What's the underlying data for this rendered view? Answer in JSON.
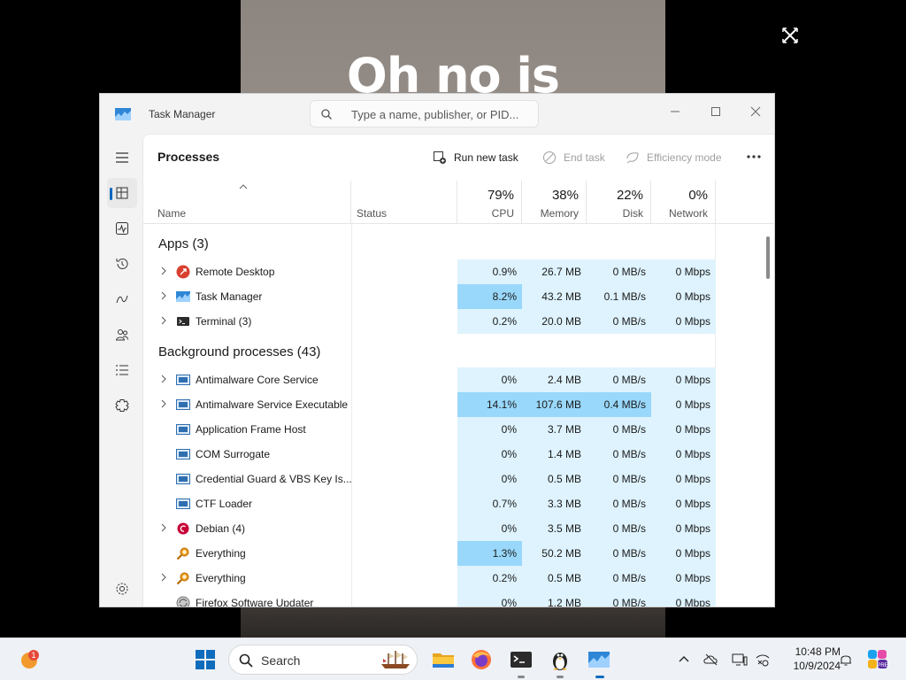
{
  "video": {
    "caption": "Oh no is"
  },
  "window": {
    "title": "Task Manager",
    "search_placeholder": "Type a name, publisher, or PID...",
    "controls": [
      "minimize-icon",
      "maximize-icon",
      "close-icon"
    ]
  },
  "nav": {
    "items": [
      "hamburger-menu-icon",
      "processes-icon",
      "performance-icon",
      "app-history-icon",
      "startup-apps-icon",
      "users-icon",
      "details-icon",
      "services-icon",
      "settings-icon"
    ],
    "selected": "processes"
  },
  "page": {
    "title": "Processes",
    "commands": {
      "run_new_task": "Run new task",
      "end_task": "End task",
      "efficiency_mode": "Efficiency mode"
    }
  },
  "columns": {
    "name": "Name",
    "status": "Status",
    "cpu": {
      "pct": "79%",
      "label": "CPU"
    },
    "memory": {
      "pct": "38%",
      "label": "Memory"
    },
    "disk": {
      "pct": "22%",
      "label": "Disk"
    },
    "network": {
      "pct": "0%",
      "label": "Network"
    }
  },
  "groups": {
    "apps": "Apps (3)",
    "background": "Background processes (43)"
  },
  "apps": [
    {
      "name": "Remote Desktop",
      "icon": "remote-desktop-icon",
      "expandable": true,
      "cpu": "0.9%",
      "memory": "26.7 MB",
      "disk": "0 MB/s",
      "network": "0 Mbps"
    },
    {
      "name": "Task Manager",
      "icon": "task-manager-icon",
      "expandable": true,
      "cpu": "8.2%",
      "memory": "43.2 MB",
      "disk": "0.1 MB/s",
      "network": "0 Mbps"
    },
    {
      "name": "Terminal (3)",
      "icon": "terminal-icon",
      "expandable": true,
      "cpu": "0.2%",
      "memory": "20.0 MB",
      "disk": "0 MB/s",
      "network": "0 Mbps"
    }
  ],
  "background": [
    {
      "name": "Antimalware Core Service",
      "icon": "service-window-icon",
      "expandable": true,
      "cpu": "0%",
      "memory": "2.4 MB",
      "disk": "0 MB/s",
      "network": "0 Mbps"
    },
    {
      "name": "Antimalware Service Executable",
      "icon": "service-window-icon",
      "expandable": true,
      "cpu": "14.1%",
      "memory": "107.6 MB",
      "disk": "0.4 MB/s",
      "network": "0 Mbps"
    },
    {
      "name": "Application Frame Host",
      "icon": "service-window-icon",
      "expandable": false,
      "cpu": "0%",
      "memory": "3.7 MB",
      "disk": "0 MB/s",
      "network": "0 Mbps"
    },
    {
      "name": "COM Surrogate",
      "icon": "service-window-icon",
      "expandable": false,
      "cpu": "0%",
      "memory": "1.4 MB",
      "disk": "0 MB/s",
      "network": "0 Mbps"
    },
    {
      "name": "Credential Guard & VBS Key Is...",
      "icon": "service-window-icon",
      "expandable": false,
      "cpu": "0%",
      "memory": "0.5 MB",
      "disk": "0 MB/s",
      "network": "0 Mbps"
    },
    {
      "name": "CTF Loader",
      "icon": "service-window-icon",
      "expandable": false,
      "cpu": "0.7%",
      "memory": "3.3 MB",
      "disk": "0 MB/s",
      "network": "0 Mbps"
    },
    {
      "name": "Debian (4)",
      "icon": "debian-icon",
      "expandable": true,
      "cpu": "0%",
      "memory": "3.5 MB",
      "disk": "0 MB/s",
      "network": "0 Mbps"
    },
    {
      "name": "Everything",
      "icon": "everything-search-icon",
      "expandable": false,
      "cpu": "1.3%",
      "memory": "50.2 MB",
      "disk": "0 MB/s",
      "network": "0 Mbps"
    },
    {
      "name": "Everything",
      "icon": "everything-search-icon",
      "expandable": true,
      "cpu": "0.2%",
      "memory": "0.5 MB",
      "disk": "0 MB/s",
      "network": "0 Mbps"
    },
    {
      "name": "Firefox Software Updater",
      "icon": "firefox-updater-icon",
      "expandable": false,
      "cpu": "0%",
      "memory": "1.2 MB",
      "disk": "0 MB/s",
      "network": "0 Mbps"
    }
  ],
  "taskbar": {
    "search_label": "Search",
    "time": "10:48 PM",
    "date": "10/9/2024",
    "weather_badge": "1",
    "copilot_badge": "PRE",
    "apps": [
      "start-icon",
      "file-explorer-icon",
      "firefox-icon",
      "terminal-icon",
      "linux-tux-icon",
      "task-manager-icon"
    ]
  }
}
